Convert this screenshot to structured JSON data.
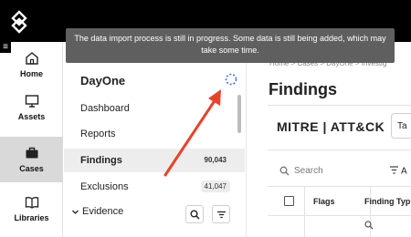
{
  "rail": {
    "items": [
      {
        "label": "Home",
        "icon": "home-icon"
      },
      {
        "label": "Assets",
        "icon": "monitor-icon"
      },
      {
        "label": "Cases",
        "icon": "briefcase-icon"
      },
      {
        "label": "Libraries",
        "icon": "book-icon"
      }
    ]
  },
  "sidebar": {
    "header": "DayOne",
    "items": [
      {
        "label": "Dashboard",
        "count": ""
      },
      {
        "label": "Reports",
        "count": ""
      },
      {
        "label": "Findings",
        "count": "90,043"
      },
      {
        "label": "Exclusions",
        "count": "41,047"
      }
    ],
    "evidence_label": "Evidence"
  },
  "main": {
    "breadcrumb": "Home  >  Cases  >  DayOne  >  Investig",
    "title": "Findings",
    "mitre_label": "MITRE | ATT&CK",
    "tactic_placeholder": "Ta",
    "search_placeholder": "Search",
    "filter_label": "A",
    "columns": [
      "Flags",
      "Finding Typ"
    ]
  },
  "tooltip": {
    "text": "The data import process is still in progress. Some data is still being added, which may take some time."
  },
  "colors": {
    "arrow": "#e8422a",
    "spinner": "#3b6fd6",
    "active_bg": "#d9d9d9"
  }
}
